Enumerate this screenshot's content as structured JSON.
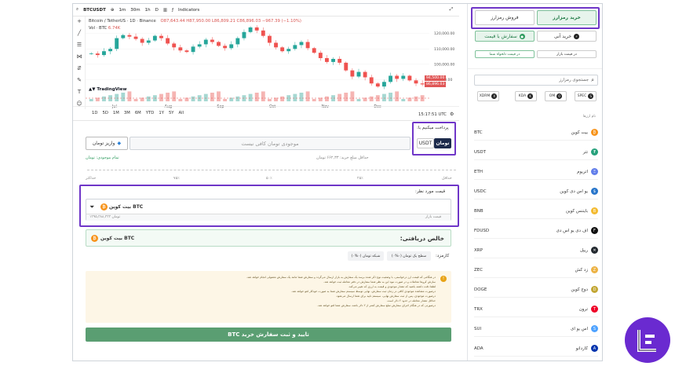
{
  "toolbar": {
    "symbol": "BTCUSDT",
    "intervals": [
      "1m",
      "30m",
      "1h",
      "D"
    ],
    "indicators": "Indicators"
  },
  "chart_head": {
    "title": "Bitcoin / TetherUS · 1D · Binance",
    "ohlc": "O87,643.44 H87,950.00 L86,809.21 C86,896.03 −967.39 (−1.10%)",
    "vol": "Vol · BTC",
    "vol_value": "6.74K",
    "brand": "TradingView",
    "price_tag": "86,896.03",
    "price_tag2": "94,500.00"
  },
  "chart_data": {
    "type": "line",
    "y_ticks": [
      "120,000.00",
      "110,000.00",
      "100,000.00",
      "90,000.00"
    ],
    "x_ticks": [
      "Jul",
      "Aug",
      "Sep",
      "Oct",
      "Nov",
      "Dec"
    ],
    "ylim": [
      82000,
      126000
    ],
    "values": [
      107000,
      106000,
      108500,
      110000,
      117000,
      119000,
      118000,
      116500,
      114000,
      115500,
      118500,
      117000,
      113500,
      111000,
      109000,
      108000,
      111500,
      113000,
      116000,
      114500,
      112000,
      110500,
      113000,
      117000,
      121000,
      124000,
      122000,
      118500,
      114000,
      111000,
      108500,
      110000,
      112500,
      114500,
      110500,
      107500,
      104000,
      101500,
      103500,
      101000,
      96000,
      92000,
      95000,
      91500,
      87500,
      85500,
      88500,
      92500,
      90500,
      92500,
      89500,
      87500,
      86900
    ]
  },
  "timeframes": [
    "1D",
    "5D",
    "1M",
    "3M",
    "6M",
    "YTD",
    "1Y",
    "5Y",
    "All"
  ],
  "clock": "15:17:51 UTC",
  "right_panel": {
    "buy_tab": "خرید رمزارز",
    "sell_tab": "فروش رمزارز",
    "market_buy": "خرید آنی",
    "limit_buy": "سفارش با قیمت",
    "market_hint": "در قیمت بازار",
    "limit_hint": "در قیمت دلخواه شما",
    "search_placeholder": "جستجوی رمزارز",
    "chips": [
      "SPEC",
      "OM",
      "KDA",
      "XDRM"
    ],
    "list_header": "نام ارزها",
    "coins": [
      {
        "sym": "BTC",
        "name": "بیت کوین",
        "color": "#f7931a",
        "g": "₿"
      },
      {
        "sym": "USDT",
        "name": "تتر",
        "color": "#26a17b",
        "g": "₮"
      },
      {
        "sym": "ETH",
        "name": "اتریوم",
        "color": "#627eea",
        "g": "Ξ"
      },
      {
        "sym": "USDC",
        "name": "یو اس دی کوین",
        "color": "#2775ca",
        "g": "$"
      },
      {
        "sym": "BNB",
        "name": "بایننس کوین",
        "color": "#f3ba2f",
        "g": "B"
      },
      {
        "sym": "FDUSD",
        "name": "اف دی یو اس دی",
        "color": "#111111",
        "g": "F"
      },
      {
        "sym": "XRP",
        "name": "ریپل",
        "color": "#23292f",
        "g": "✕"
      },
      {
        "sym": "ZEC",
        "name": "زد کش",
        "color": "#ecb244",
        "g": "Z"
      },
      {
        "sym": "DOGE",
        "name": "دوج کوین",
        "color": "#c2a633",
        "g": "D"
      },
      {
        "sym": "TRX",
        "name": "ترون",
        "color": "#ef0027",
        "g": "T"
      },
      {
        "sym": "SUI",
        "name": "اس یو ای",
        "color": "#4da2ff",
        "g": "S"
      },
      {
        "sym": "ADA",
        "name": "کاردانو",
        "color": "#0033ad",
        "g": "A"
      }
    ]
  },
  "pay": {
    "label": "پرداخت میکنیم با:",
    "toman": "تومان",
    "usdt": "USDT",
    "balance_msg": "موجودی تومان کافی نیست",
    "deposit": "واریز تومان",
    "balance_label": "تمام موجودی: تومان",
    "min_label": "حداقل مبلغ خرید: ۶۶۲,۳۳ تومان",
    "slider_left": "حداقل",
    "slider_right": "حداکثر",
    "slider_marks": [
      "۲۵٪",
      "۵۰٪",
      "۷۵٪"
    ]
  },
  "target": {
    "label": "قیمت مورد نظر:",
    "coin": "بیت کوین BTC",
    "price_hint": "قیمت بازار",
    "price_value": "۱۳۹۵,۳۸۸,۳۳۳ تومان"
  },
  "receive": {
    "label": "خالص دریافتی:",
    "value": "بیت کوین BTC"
  },
  "fee": {
    "label": "کارمزد:",
    "opt1": "سطح یک تومان (۰%۰)",
    "opt2": "شبکه تومان (۰%۰)"
  },
  "notes": [
    "در هنگامی که قیمت ارز درخواستی، با وضعیت نوع ذکر شده برسد یک سفارش به بازار ارسال می‌گردد و سفارش شما مانند یک سفارش معمولی انجام خواهد شد.",
    "سازش کروها معاملات و در صورت نبود این به نظر شما سفارش در دفتر معامله ثبت خواهد شد.",
    "لطفا دقت داشته باشید که مقدار موجودی و قیمت به ارزی که تغییر می‌کند.",
    "درصورت مشاهده موجودی کافی در زمان ثبت سفارش، نهایی توسط سیستم سفارش شما به صورت خودکار لغو خواهد شد.",
    "درصورت موجودی، پس از ثبت سفارش نهایی، سیستم تایید برای شما ارسال می‌شود.",
    "حداقل مقدار معامله در حدود ۲ دلار است.",
    "درصورتی که در هنگام اجرای سفارش مبلغ سفارش کمتر از ۲ دلار باشد، سفارش شما لغو خواهد شد."
  ],
  "submit": "تایید و ثبت سفارش خرید BTC"
}
